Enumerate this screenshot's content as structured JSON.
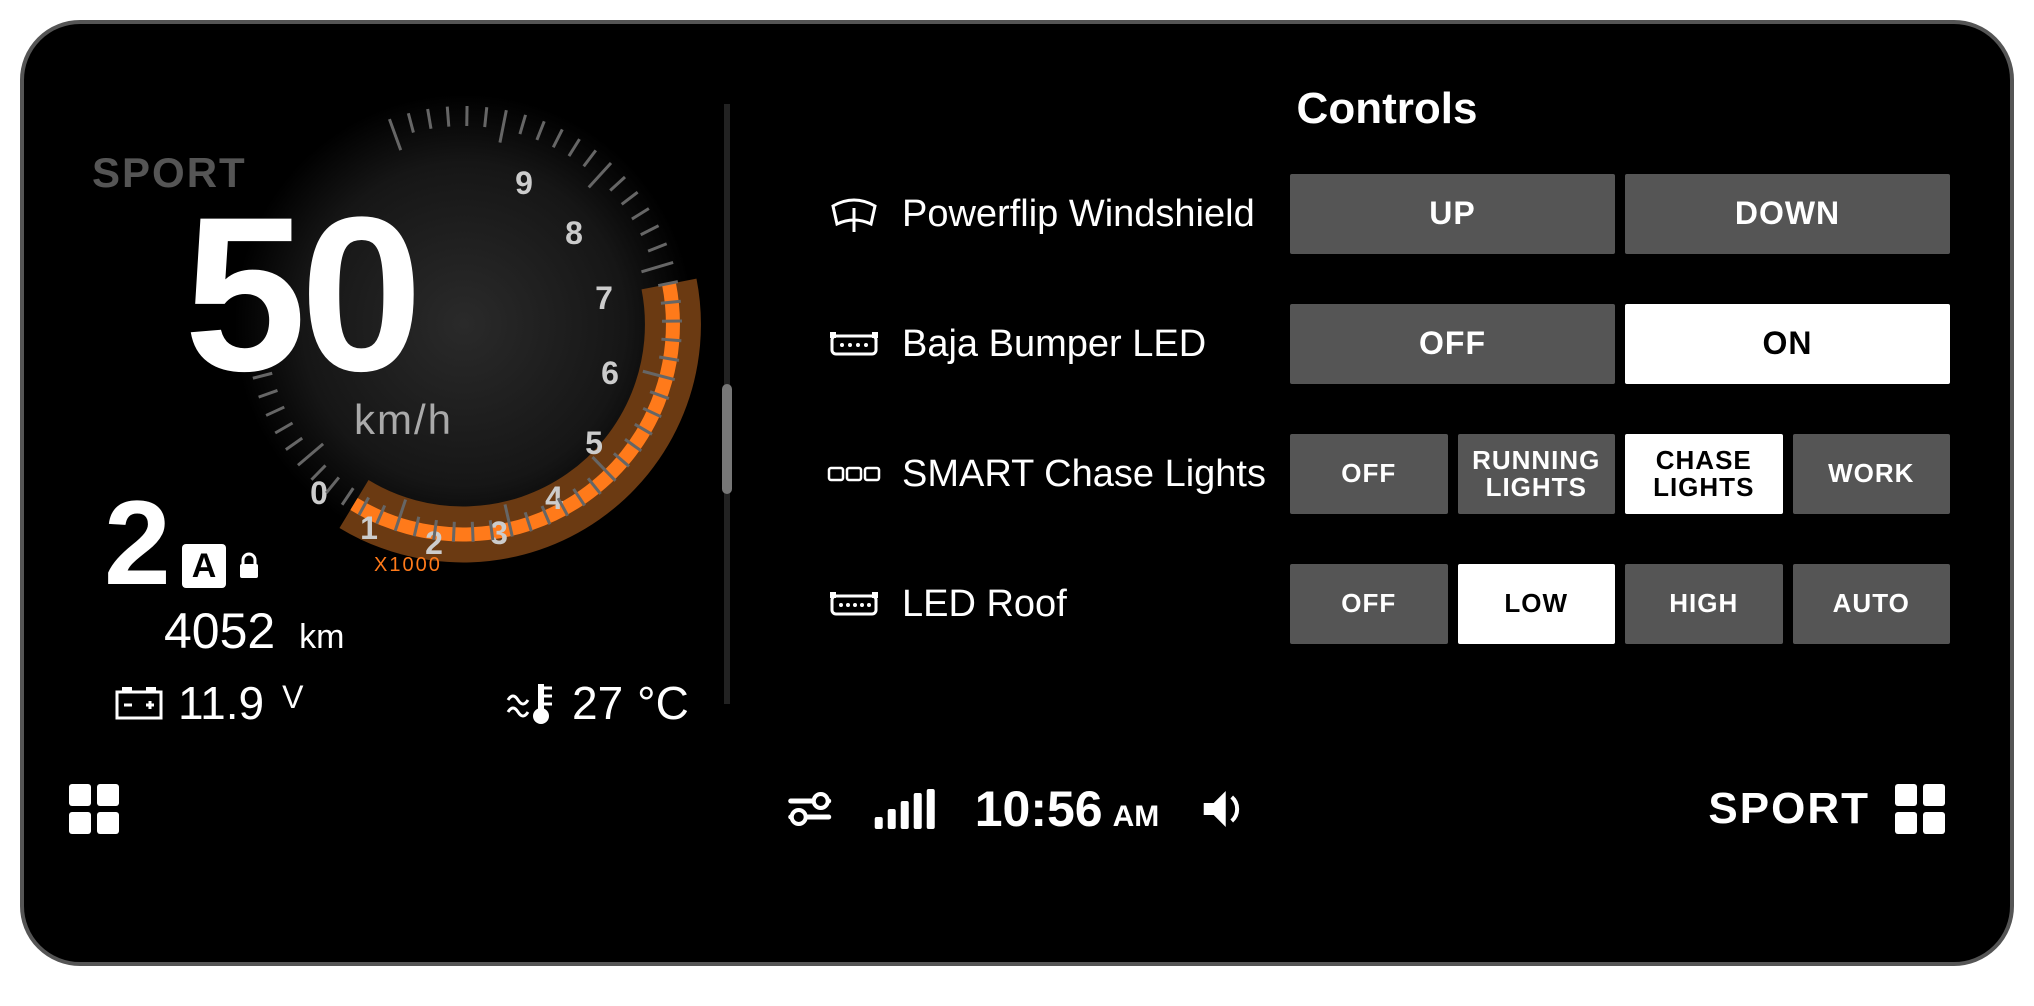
{
  "gauge": {
    "mode": "SPORT",
    "speed": "50",
    "speed_unit": "km/h",
    "gear": "2",
    "gear_badge": "A",
    "odometer": "4052",
    "odometer_unit": "km",
    "rpm_multiplier": "X1000",
    "rpm_ticks": [
      "0",
      "1",
      "2",
      "3",
      "4",
      "5",
      "6",
      "7",
      "8",
      "9"
    ],
    "voltage": "11.9",
    "voltage_unit": "V",
    "temperature": "27",
    "temperature_unit": "°C"
  },
  "controls": {
    "title": "Controls",
    "rows": [
      {
        "icon": "windshield-icon",
        "label": "Powerflip Windshield",
        "buttons": [
          "UP",
          "DOWN"
        ],
        "active": null
      },
      {
        "icon": "bumper-led-icon",
        "label": "Baja Bumper LED",
        "buttons": [
          "OFF",
          "ON"
        ],
        "active": 1
      },
      {
        "icon": "chase-lights-icon",
        "label": "SMART Chase Lights",
        "buttons": [
          "OFF",
          "RUNNING LIGHTS",
          "CHASE LIGHTS",
          "WORK"
        ],
        "active": 2
      },
      {
        "icon": "roof-led-icon",
        "label": "LED Roof",
        "buttons": [
          "OFF",
          "LOW",
          "HIGH",
          "AUTO"
        ],
        "active": 1
      }
    ]
  },
  "bottombar": {
    "time": "10:56",
    "ampm": "AM",
    "mode": "SPORT"
  }
}
